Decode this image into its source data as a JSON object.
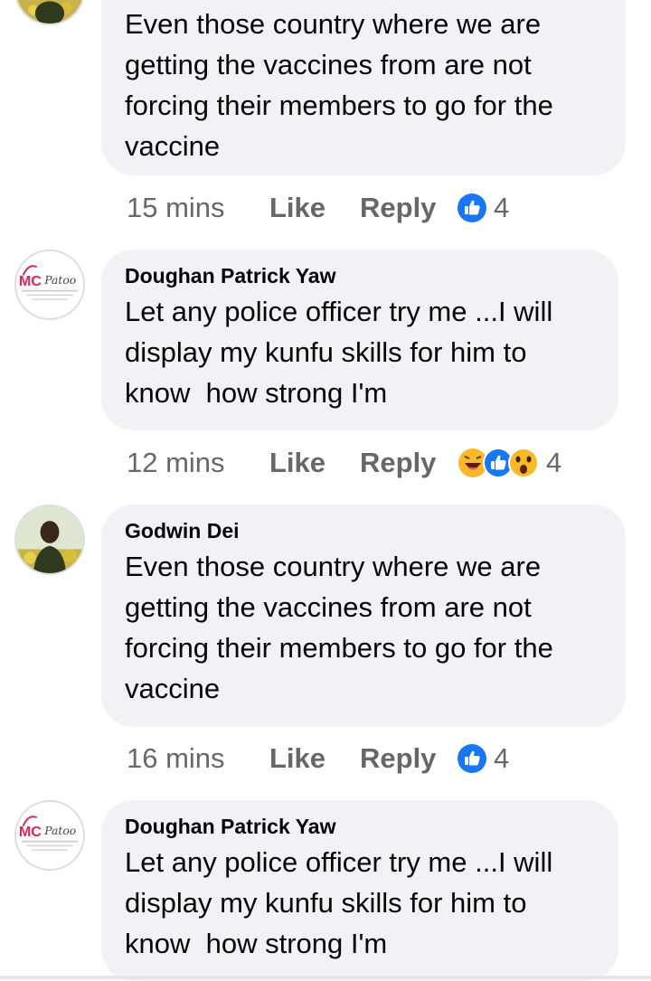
{
  "comments": [
    {
      "author": "",
      "text": "Even those country where we are getting the vaccines from are not forcing their members to go for the vaccine",
      "time": "15 mins",
      "like_label": "Like",
      "reply_label": "Reply",
      "reactions": [
        "like"
      ],
      "reaction_count": "4",
      "avatar": "godwin-photo"
    },
    {
      "author": "Doughan Patrick Yaw",
      "text": "Let any police officer try me ...I will display my kunfu skills for him to know  how strong I'm",
      "time": "12 mins",
      "like_label": "Like",
      "reply_label": "Reply",
      "reactions": [
        "haha",
        "like",
        "wow"
      ],
      "reaction_count": "4",
      "avatar": "mc-patoo-logo"
    },
    {
      "author": "Godwin Dei",
      "text": "Even those country where we are getting the vaccines from are not forcing their members to go for the vaccine",
      "time": "16 mins",
      "like_label": "Like",
      "reply_label": "Reply",
      "reactions": [
        "like"
      ],
      "reaction_count": "4",
      "avatar": "godwin-photo"
    },
    {
      "author": "Doughan Patrick Yaw",
      "text": "Let any police officer try me ...I will display my kunfu skills for him to know  how strong I'm",
      "avatar": "mc-patoo-logo"
    }
  ],
  "logo_text": "MC Patoo",
  "colors": {
    "bubble": "#f0f2f5",
    "meta_text": "#65676b",
    "like_blue": "#1877f2",
    "haha_yellow": "#f7b928",
    "logo_red": "#e0245e"
  }
}
